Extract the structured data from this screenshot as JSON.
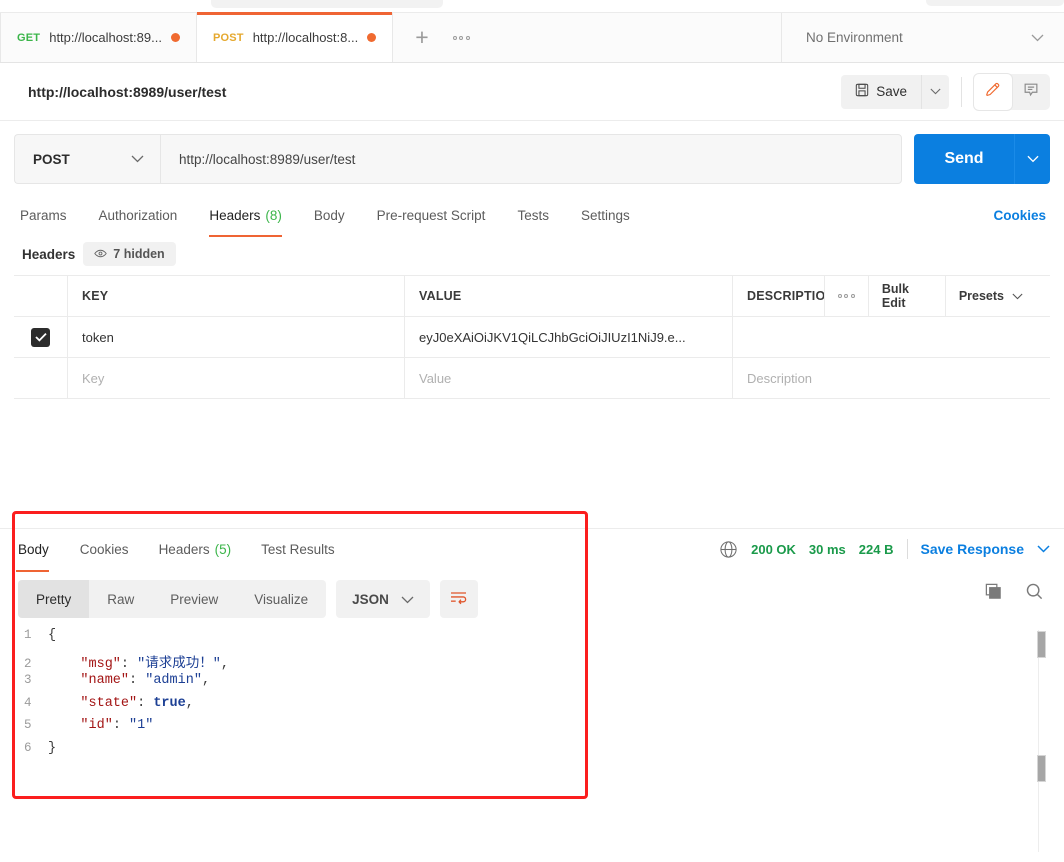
{
  "tabs": [
    {
      "method": "GET",
      "url": "http://localhost:89...",
      "unsaved": true,
      "active": false
    },
    {
      "method": "POST",
      "url": "http://localhost:8...",
      "unsaved": true,
      "active": true
    }
  ],
  "tab_actions": {
    "new_tab": "+",
    "more": "•••"
  },
  "environment": {
    "label": "No Environment",
    "caret": "⌄"
  },
  "request": {
    "title": "http://localhost:8989/user/test",
    "save_label": "Save",
    "save_caret": "⌄",
    "edit_icon": "pencil-icon",
    "comment_icon": "comment-icon"
  },
  "urlbar": {
    "method": "POST",
    "method_caret": "⌄",
    "url": "http://localhost:8989/user/test",
    "send_label": "Send",
    "send_caret": "⌄"
  },
  "request_tabs": [
    {
      "label": "Params",
      "count": "",
      "active": false
    },
    {
      "label": "Authorization",
      "count": "",
      "active": false
    },
    {
      "label": "Headers",
      "count": "(8)",
      "active": true
    },
    {
      "label": "Body",
      "count": "",
      "active": false
    },
    {
      "label": "Pre-request Script",
      "count": "",
      "active": false
    },
    {
      "label": "Tests",
      "count": "",
      "active": false
    },
    {
      "label": "Settings",
      "count": "",
      "active": false
    }
  ],
  "cookies_link": "Cookies",
  "headers_section": {
    "title": "Headers",
    "hidden_label": "7 hidden",
    "eye_icon": "eye-icon",
    "columns": {
      "key": "KEY",
      "value": "VALUE",
      "description": "DESCRIPTIO"
    },
    "tools": {
      "more": "•••",
      "bulk_edit": "Bulk Edit",
      "presets": "Presets",
      "presets_caret": "⌄"
    },
    "rows": [
      {
        "checked": true,
        "key": "token",
        "value": "eyJ0eXAiOiJKV1QiLCJhbGciOiJIUzI1NiJ9.e...",
        "description": ""
      }
    ],
    "placeholders": {
      "key": "Key",
      "value": "Value",
      "description": "Description"
    }
  },
  "response": {
    "tabs": [
      {
        "label": "Body",
        "count": "",
        "active": true
      },
      {
        "label": "Cookies",
        "count": "",
        "active": false
      },
      {
        "label": "Headers",
        "count": "(5)",
        "active": false
      },
      {
        "label": "Test Results",
        "count": "",
        "active": false
      }
    ],
    "status": {
      "code": "200 OK",
      "time": "30 ms",
      "size": "224 B"
    },
    "globe_icon": "globe-icon",
    "save_response": "Save Response",
    "save_response_caret": "⌄",
    "view_modes": [
      {
        "label": "Pretty",
        "active": true
      },
      {
        "label": "Raw",
        "active": false
      },
      {
        "label": "Preview",
        "active": false
      },
      {
        "label": "Visualize",
        "active": false
      }
    ],
    "format": {
      "label": "JSON",
      "caret": "⌄"
    },
    "wrap_icon": "word-wrap-icon",
    "copy_icon": "copy-icon",
    "search_icon": "search-icon",
    "body_lines": [
      {
        "num": "1",
        "tokens": [
          {
            "t": "{",
            "c": "k-brace"
          }
        ]
      },
      {
        "num": "2",
        "tokens": [
          {
            "t": "    ",
            "c": "k-punc"
          },
          {
            "t": "\"msg\"",
            "c": "k-key"
          },
          {
            "t": ": ",
            "c": "k-punc"
          },
          {
            "t": "\"请求成功！\"",
            "c": "k-str"
          },
          {
            "t": ",",
            "c": "k-punc"
          }
        ]
      },
      {
        "num": "3",
        "tokens": [
          {
            "t": "    ",
            "c": "k-punc"
          },
          {
            "t": "\"name\"",
            "c": "k-key"
          },
          {
            "t": ": ",
            "c": "k-punc"
          },
          {
            "t": "\"admin\"",
            "c": "k-str"
          },
          {
            "t": ",",
            "c": "k-punc"
          }
        ]
      },
      {
        "num": "4",
        "tokens": [
          {
            "t": "    ",
            "c": "k-punc"
          },
          {
            "t": "\"state\"",
            "c": "k-key"
          },
          {
            "t": ": ",
            "c": "k-punc"
          },
          {
            "t": "true",
            "c": "k-bool"
          },
          {
            "t": ",",
            "c": "k-punc"
          }
        ]
      },
      {
        "num": "5",
        "tokens": [
          {
            "t": "    ",
            "c": "k-punc"
          },
          {
            "t": "\"id\"",
            "c": "k-key"
          },
          {
            "t": ": ",
            "c": "k-punc"
          },
          {
            "t": "\"1\"",
            "c": "k-str"
          }
        ]
      },
      {
        "num": "6",
        "tokens": [
          {
            "t": "}",
            "c": "k-brace"
          }
        ]
      }
    ]
  },
  "annotation": {
    "color": "#fb1e1e"
  }
}
